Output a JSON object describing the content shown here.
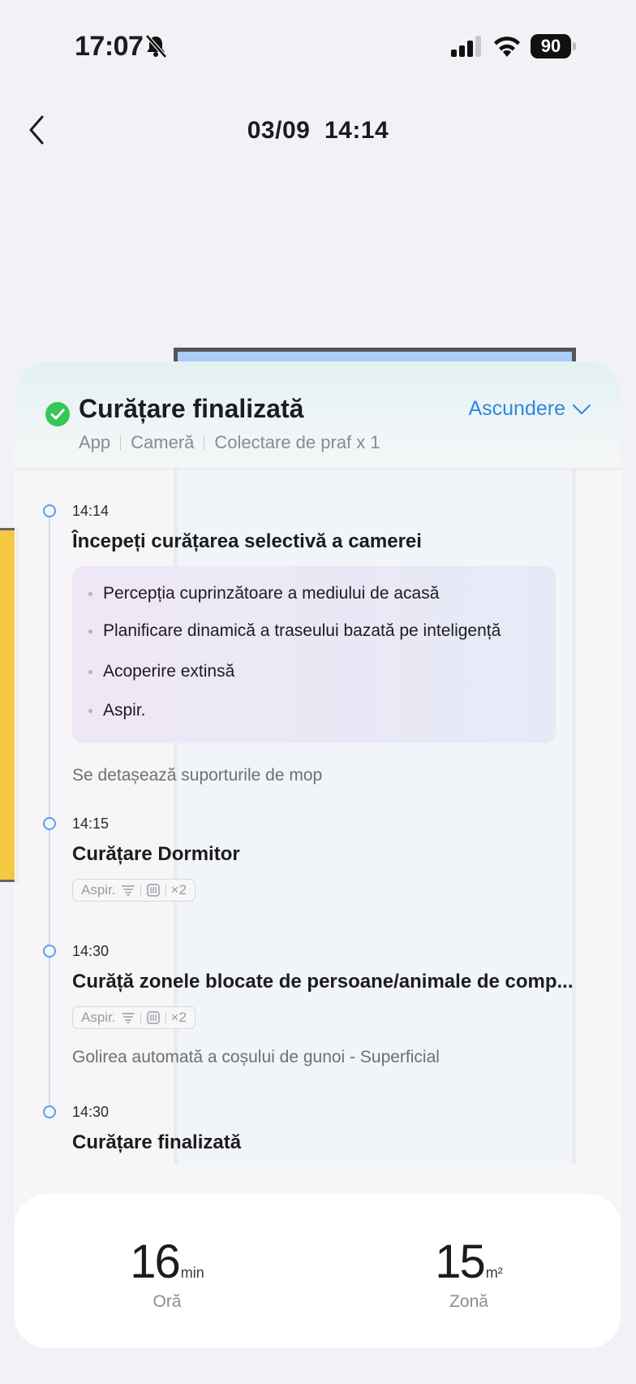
{
  "status_bar": {
    "time": "17:07",
    "battery": "90"
  },
  "nav": {
    "title": "03/09  14:14",
    "back_icon": "chevron-left-icon"
  },
  "summary": {
    "title": "Curățare finalizată",
    "hide_label": "Ascundere",
    "meta": [
      "App",
      "Cameră",
      "Colectare de praf x 1"
    ],
    "status_color": "#34c759",
    "accent_color": "#2f86e0"
  },
  "timeline": [
    {
      "time": "14:14",
      "title": "Începeți curățarea selectivă a camerei",
      "features": [
        "Percepția cuprinzătoare a mediului de acasă",
        "Planificare dinamică a traseului bazată pe inteligență",
        "Acoperire extinsă",
        "Aspir."
      ],
      "note": "Se detașează suporturile de mop"
    },
    {
      "time": "14:15",
      "title": "Curățare Dormitor",
      "tag": {
        "mode": "Aspir.",
        "passes": "×2"
      }
    },
    {
      "time": "14:30",
      "title": "Curăță zonele blocate de persoane/animale de comp...",
      "tag": {
        "mode": "Aspir.",
        "passes": "×2"
      },
      "note": "Golirea automată a coșului de gunoi - Superficial"
    },
    {
      "time": "14:30",
      "title": "Curățare finalizată"
    }
  ],
  "stats": {
    "duration": {
      "value": "16",
      "unit": "min",
      "label": "Oră"
    },
    "area": {
      "value": "15",
      "unit": "m²",
      "label": "Zonă"
    }
  }
}
